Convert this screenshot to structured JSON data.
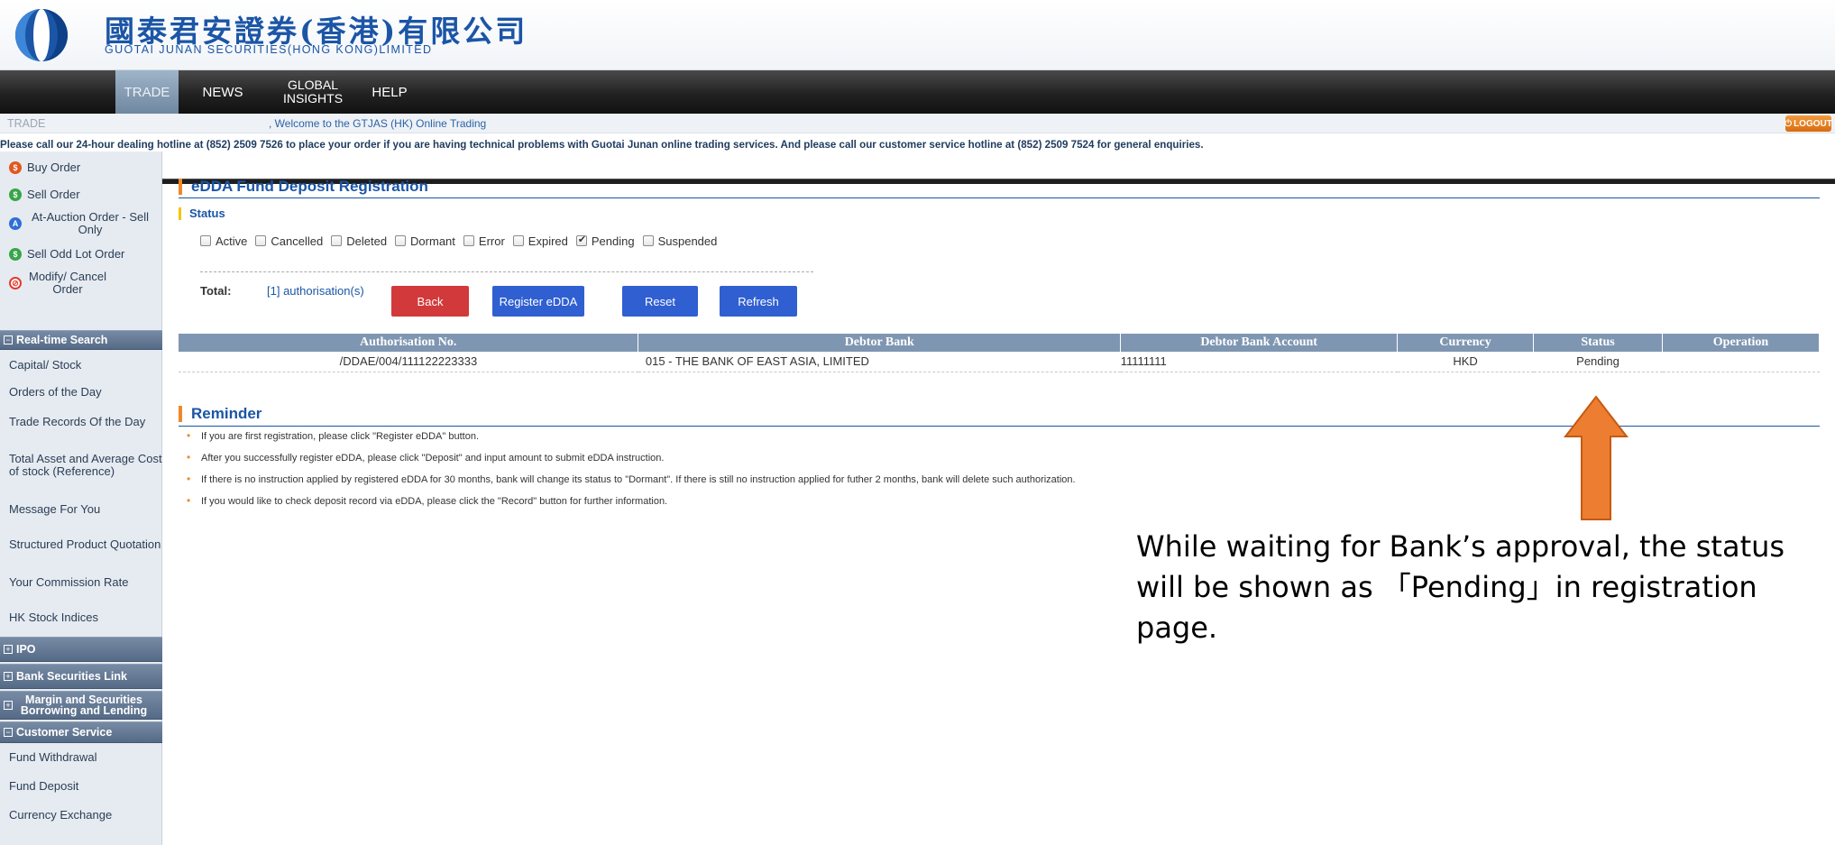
{
  "header": {
    "logo_cn": "國泰君安證券(香港)有限公司",
    "logo_en": "GUOTAI JUNAN SECURITIES(HONG KONG)LIMITED"
  },
  "nav": {
    "items": [
      "TRADE",
      "NEWS",
      "GLOBAL INSIGHTS",
      "HELP"
    ],
    "active": "TRADE"
  },
  "subbar": {
    "section": "TRADE",
    "welcome": ", Welcome to the GTJAS (HK) Online Trading",
    "logout_label": "LOGOUT"
  },
  "hotline": "Please call our 24-hour dealing hotline at (852) 2509 7526 to place your order if you are having technical problems with Guotai Junan online trading services. And please call our customer service hotline at (852) 2509 7524 for general enquiries.",
  "sidebar": {
    "orders": [
      {
        "label": "Buy Order",
        "icon": "buy-icon",
        "glyph": "$"
      },
      {
        "label": "Sell Order",
        "icon": "sell-icon",
        "glyph": "$"
      },
      {
        "label": "At-Auction Order - Sell Only",
        "icon": "auction-icon",
        "glyph": "A"
      },
      {
        "label": "Sell Odd Lot Order",
        "icon": "odd-lot-icon",
        "glyph": "$"
      },
      {
        "label": "Modify/ Cancel Order",
        "icon": "no-entry-icon",
        "glyph": "⊘"
      }
    ],
    "realtime_header": "Real-time Search",
    "realtime_items": [
      "Capital/ Stock",
      "Orders of the Day",
      "Trade Records Of the Day",
      "Total Asset and Average Cost of stock (Reference)",
      "Message For You",
      "Structured Product Quotation",
      "Your Commission Rate",
      "HK Stock Indices"
    ],
    "ipo_header": "IPO",
    "bank_header": "Bank Securities Link",
    "margin_header": "Margin and Securities Borrowing and Lending",
    "customer_header": "Customer Service",
    "customer_items": [
      "Fund Withdrawal",
      "Fund Deposit",
      "Currency Exchange"
    ]
  },
  "main": {
    "title": "eDDA Fund Deposit Registration",
    "status_label": "Status",
    "status_filters": [
      {
        "label": "Active",
        "checked": false
      },
      {
        "label": "Cancelled",
        "checked": false
      },
      {
        "label": "Deleted",
        "checked": false
      },
      {
        "label": "Dormant",
        "checked": false
      },
      {
        "label": "Error",
        "checked": false
      },
      {
        "label": "Expired",
        "checked": false
      },
      {
        "label": "Pending",
        "checked": true
      },
      {
        "label": "Suspended",
        "checked": false
      }
    ],
    "total_label": "Total:",
    "total_value": "[1] authorisation(s)",
    "buttons": {
      "back": "Back",
      "register": "Register eDDA",
      "reset": "Reset",
      "refresh": "Refresh"
    },
    "table": {
      "columns": [
        "Authorisation No.",
        "Debtor Bank",
        "Debtor Bank Account",
        "Currency",
        "Status",
        "Operation"
      ],
      "rows": [
        [
          "/DDAE/004/111122223333",
          "015 - THE BANK OF EAST ASIA, LIMITED",
          "11111111",
          "HKD",
          "Pending",
          ""
        ]
      ]
    },
    "reminder_title": "Reminder",
    "reminders": [
      "If you are first registration, please click \"Register eDDA\" button.",
      "After you successfully register eDDA, please click \"Deposit\" and input amount to submit eDDA instruction.",
      "If there is no instruction applied by registered eDDA for 30 months, bank will change its status to \"Dormant\". If there is still no instruction applied for futher 2 months, bank will delete such authorization.",
      "If you would like to check deposit record via eDDA, please click the \"Record\" button for further information."
    ]
  },
  "annotation": "While waiting for Bank’s approval, the status will be shown as 「Pending」in registration page.",
  "colors": {
    "brand_blue": "#1b55a6",
    "accent_orange": "#f0882a",
    "arrow_orange": "#ed7d31",
    "table_header": "#7f96b2"
  }
}
